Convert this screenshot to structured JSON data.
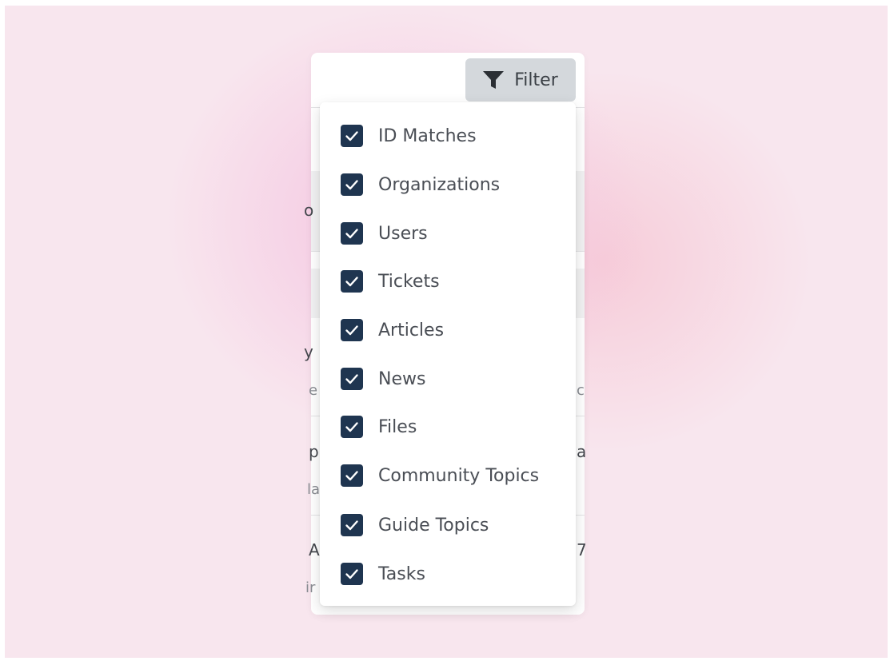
{
  "filter_button": {
    "label": "Filter",
    "icon": "filter-icon"
  },
  "filter_menu": {
    "checkbox_color": "#1f3550",
    "options": [
      {
        "label": "ID Matches",
        "checked": true
      },
      {
        "label": "Organizations",
        "checked": true
      },
      {
        "label": "Users",
        "checked": true
      },
      {
        "label": "Tickets",
        "checked": true
      },
      {
        "label": "Articles",
        "checked": true
      },
      {
        "label": "News",
        "checked": true
      },
      {
        "label": "Files",
        "checked": true
      },
      {
        "label": "Community Topics",
        "checked": true
      },
      {
        "label": "Guide Topics",
        "checked": true
      },
      {
        "label": "Tasks",
        "checked": true
      }
    ]
  },
  "background_fragments": [
    "o",
    "y",
    "e",
    "c",
    "p",
    "a",
    "la",
    "A",
    "7",
    "ir"
  ]
}
